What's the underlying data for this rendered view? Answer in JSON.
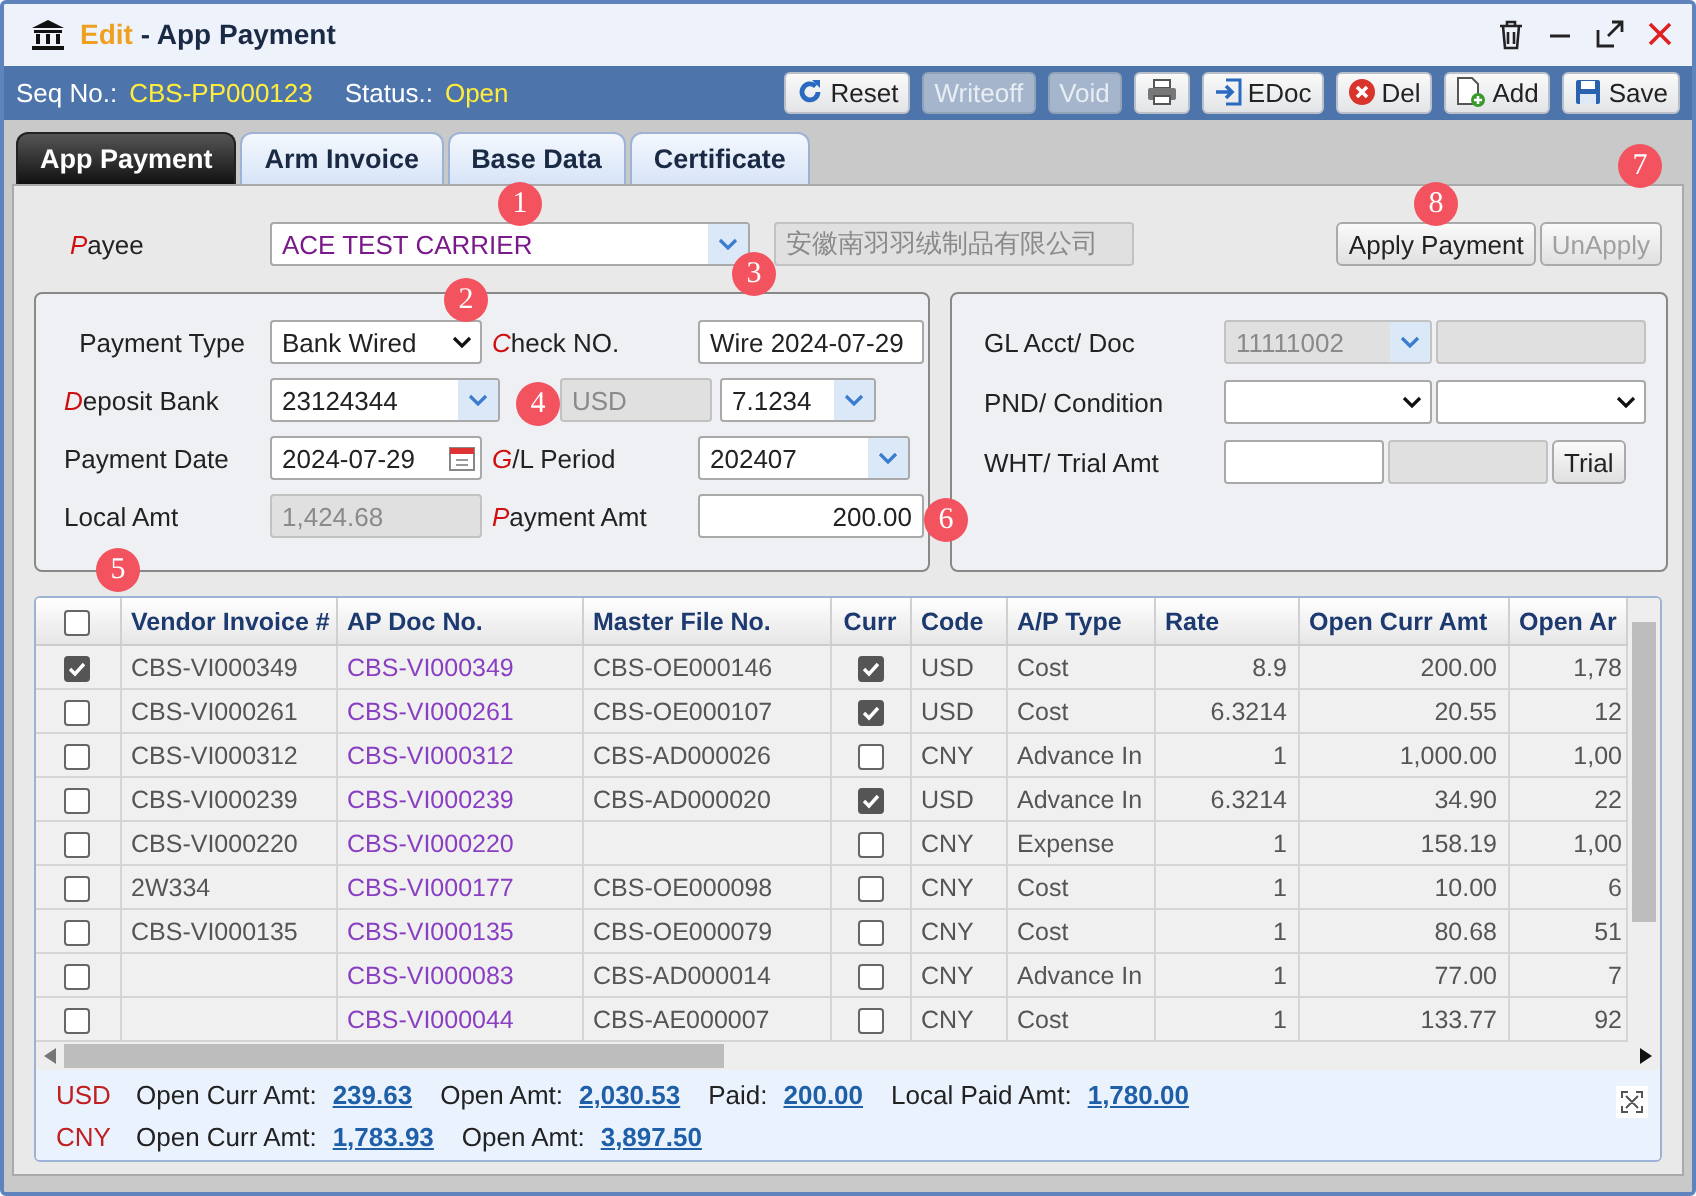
{
  "window": {
    "mode": "Edit",
    "separator": "-",
    "title": "App Payment"
  },
  "header": {
    "seq_label": "Seq No.:",
    "seq_value": "CBS-PP000123",
    "status_label": "Status.:",
    "status_value": "Open"
  },
  "toolbar": [
    {
      "label": "Reset",
      "disabled": false
    },
    {
      "label": "Writeoff",
      "disabled": true
    },
    {
      "label": "Void",
      "disabled": true
    },
    {
      "disabled": false
    },
    {
      "label": "EDoc",
      "disabled": false
    },
    {
      "label": "Del",
      "disabled": false
    },
    {
      "label": "Add",
      "disabled": false
    },
    {
      "label": "Save",
      "disabled": false
    }
  ],
  "tabs": [
    {
      "label": "App Payment",
      "selected": true
    },
    {
      "label": "Arm Invoice",
      "selected": false
    },
    {
      "label": "Base Data",
      "selected": false
    },
    {
      "label": "Certificate",
      "selected": false
    }
  ],
  "payee": {
    "label": "Payee",
    "required": true,
    "value": "ACE TEST CARRIER",
    "name_cn": "安徽南羽羽绒制品有限公司"
  },
  "payee_buttons": [
    {
      "label": "Apply Payment",
      "disabled": false
    },
    {
      "label": "UnApply",
      "disabled": true
    }
  ],
  "left_form": [
    {
      "label": "Payment Type",
      "required": false,
      "fields": [
        {
          "kind": "select",
          "value": "Bank Wired",
          "disabled": false
        }
      ]
    },
    {
      "label": "Check NO.",
      "required": true,
      "fields": [
        {
          "kind": "text",
          "value": "Wire 2024-07-29",
          "disabled": false
        }
      ]
    },
    {
      "label": "Deposit Bank",
      "required": true,
      "fields": [
        {
          "kind": "combo",
          "value": "23124344",
          "disabled": false
        },
        {
          "kind": "text",
          "value": "USD",
          "disabled": true
        },
        {
          "kind": "combo",
          "value": "7.1234",
          "disabled": false
        }
      ]
    },
    {
      "label": "Payment Date",
      "required": false,
      "fields": [
        {
          "kind": "date",
          "value": "2024-07-29",
          "disabled": false
        }
      ]
    },
    {
      "label": "G/L Period",
      "required": true,
      "fields": [
        {
          "kind": "combo",
          "value": "202407",
          "disabled": false
        }
      ]
    },
    {
      "label": "Local Amt",
      "required": false,
      "fields": [
        {
          "kind": "text",
          "value": "1,424.68",
          "disabled": true
        }
      ]
    },
    {
      "label": "Payment Amt",
      "required": true,
      "fields": [
        {
          "kind": "number",
          "value": "200.00",
          "disabled": false
        }
      ]
    }
  ],
  "right_form": [
    {
      "label": "GL Acct/ Doc",
      "fields": [
        {
          "kind": "combo",
          "value": "11111002",
          "disabled": true
        },
        {
          "kind": "text",
          "disabled": true
        }
      ]
    },
    {
      "label": "PND/  Condition",
      "fields": [
        {
          "kind": "select",
          "disabled": false
        },
        {
          "kind": "select",
          "disabled": false
        }
      ]
    },
    {
      "label": "WHT/ Trial Amt",
      "fields": [
        {
          "kind": "text",
          "disabled": false
        },
        {
          "kind": "text",
          "disabled": true
        },
        {
          "kind": "button",
          "value": "Trial",
          "disabled": false
        }
      ]
    }
  ],
  "table": {
    "all_checked": false,
    "columns": [
      "Vendor Invoice #",
      "AP Doc No.",
      "Master File No.",
      "Curr",
      "Code",
      "A/P Type",
      "Rate",
      "Open Curr Amt",
      "Open Ar"
    ],
    "rows": [
      {
        "checked": true,
        "vendor_invoice": "CBS-VI000349",
        "ap_doc": "CBS-VI000349",
        "master_file": "CBS-OE000146",
        "curr": true,
        "code": "USD",
        "ap_type": "Cost",
        "rate": "8.9",
        "open_curr_amt": "200.00",
        "open_amt": "1,78"
      },
      {
        "checked": false,
        "vendor_invoice": "CBS-VI000261",
        "ap_doc": "CBS-VI000261",
        "master_file": "CBS-OE000107",
        "curr": true,
        "code": "USD",
        "ap_type": "Cost",
        "rate": "6.3214",
        "open_curr_amt": "20.55",
        "open_amt": "12"
      },
      {
        "checked": false,
        "vendor_invoice": "CBS-VI000312",
        "ap_doc": "CBS-VI000312",
        "master_file": "CBS-AD000026",
        "curr": false,
        "code": "CNY",
        "ap_type": "Advance In",
        "rate": "1",
        "open_curr_amt": "1,000.00",
        "open_amt": "1,00"
      },
      {
        "checked": false,
        "vendor_invoice": "CBS-VI000239",
        "ap_doc": "CBS-VI000239",
        "master_file": "CBS-AD000020",
        "curr": true,
        "code": "USD",
        "ap_type": "Advance In",
        "rate": "6.3214",
        "open_curr_amt": "34.90",
        "open_amt": "22"
      },
      {
        "checked": false,
        "vendor_invoice": "CBS-VI000220",
        "ap_doc": "CBS-VI000220",
        "curr": false,
        "code": "CNY",
        "ap_type": "Expense",
        "rate": "1",
        "open_curr_amt": "158.19",
        "open_amt": "1,00"
      },
      {
        "checked": false,
        "vendor_invoice": "2W334",
        "ap_doc": "CBS-VI000177",
        "master_file": "CBS-OE000098",
        "curr": false,
        "code": "CNY",
        "ap_type": "Cost",
        "rate": "1",
        "open_curr_amt": "10.00",
        "open_amt": "6"
      },
      {
        "checked": false,
        "vendor_invoice": "CBS-VI000135",
        "ap_doc": "CBS-VI000135",
        "master_file": "CBS-OE000079",
        "curr": false,
        "code": "CNY",
        "ap_type": "Cost",
        "rate": "1",
        "open_curr_amt": "80.68",
        "open_amt": "51"
      },
      {
        "checked": false,
        "ap_doc": "CBS-VI000083",
        "master_file": "CBS-AD000014",
        "curr": false,
        "code": "CNY",
        "ap_type": "Advance In",
        "rate": "1",
        "open_curr_amt": "77.00",
        "open_amt": "7"
      },
      {
        "checked": false,
        "ap_doc": "CBS-VI000044",
        "master_file": "CBS-AE000007",
        "curr": false,
        "code": "CNY",
        "ap_type": "Cost",
        "rate": "1",
        "open_curr_amt": "133.77",
        "open_amt": "92"
      }
    ]
  },
  "summary": [
    {
      "currency": "USD",
      "items": [
        {
          "label": "Open Curr Amt:",
          "value": "239.63"
        },
        {
          "label": "Open Amt:",
          "value": "2,030.53"
        },
        {
          "label": "Paid:",
          "value": "200.00"
        },
        {
          "label": "Local Paid Amt:",
          "value": "1,780.00"
        }
      ]
    },
    {
      "currency": "CNY",
      "items": [
        {
          "label": "Open Curr Amt:",
          "value": "1,783.93"
        },
        {
          "label": "Open Amt:",
          "value": "3,897.50"
        }
      ]
    }
  ],
  "callouts": [
    "1",
    "2",
    "3",
    "4",
    "5",
    "6",
    "7",
    "8"
  ]
}
